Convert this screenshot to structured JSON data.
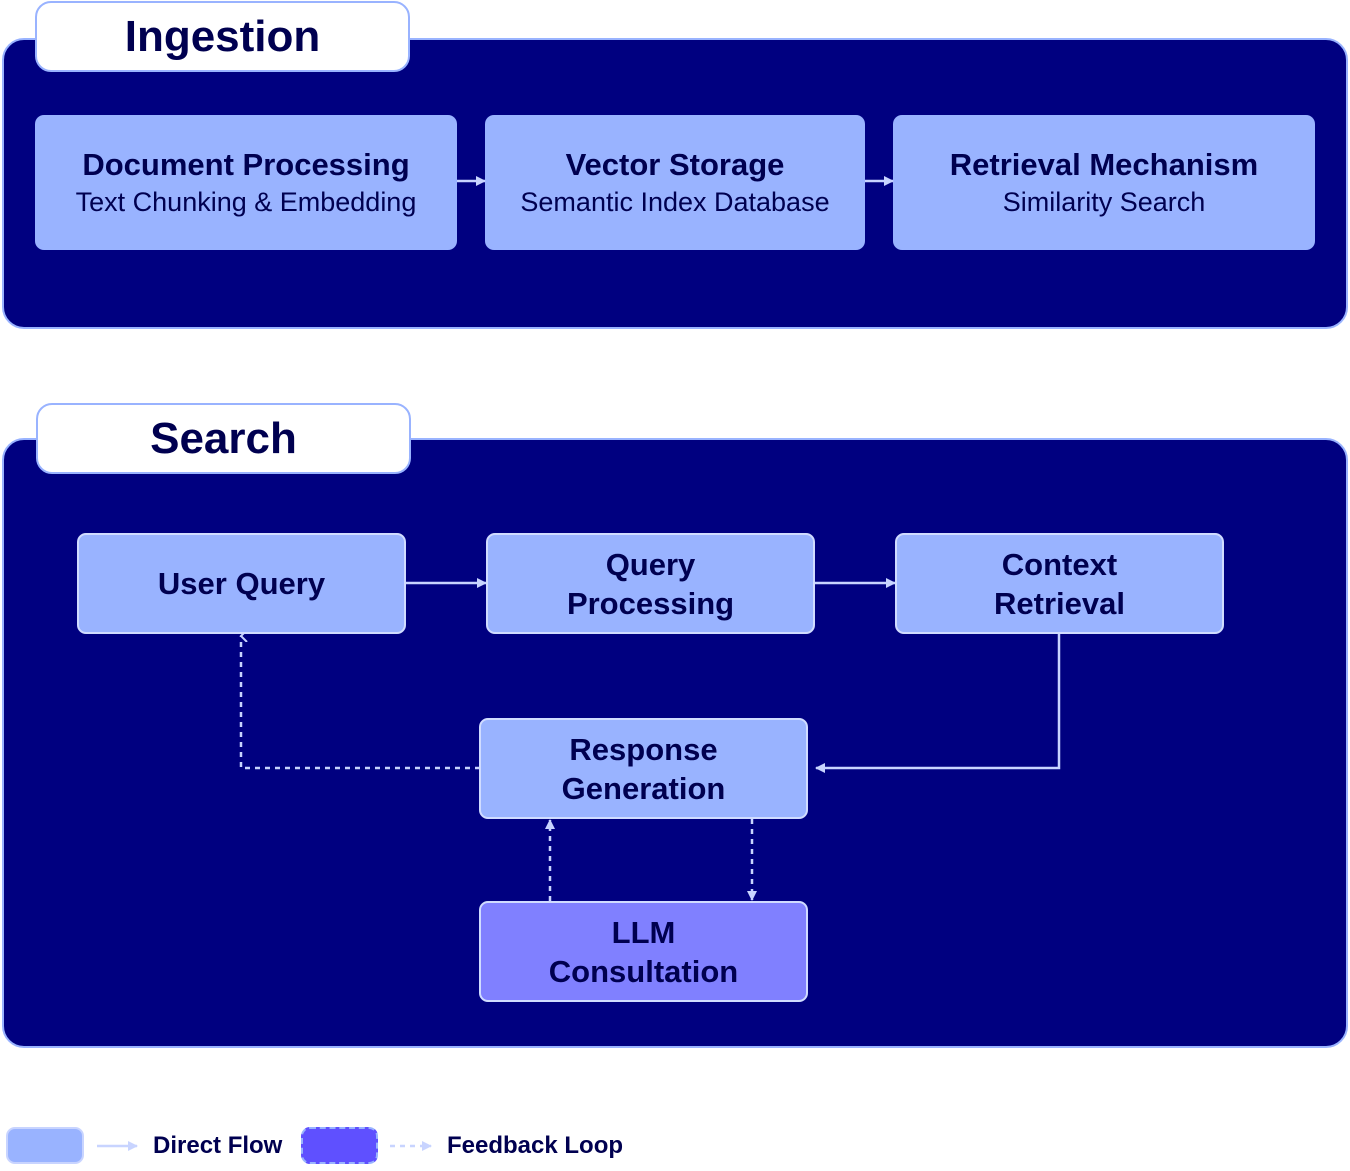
{
  "ingestion": {
    "title": "Ingestion",
    "nodes": [
      {
        "title": "Document Processing",
        "subtitle": "Text Chunking & Embedding"
      },
      {
        "title": "Vector Storage",
        "subtitle": "Semantic Index Database"
      },
      {
        "title": "Retrieval Mechanism",
        "subtitle": "Similarity Search"
      }
    ]
  },
  "search": {
    "title": "Search",
    "nodes": {
      "user_query": "User Query",
      "query_processing": [
        "Query",
        "Processing"
      ],
      "context_retrieval": [
        "Context",
        "Retrieval"
      ],
      "response_generation": [
        "Response",
        "Generation"
      ],
      "llm_consultation": [
        "LLM",
        "Consultation"
      ]
    }
  },
  "legend": {
    "direct_flow": "Direct Flow",
    "feedback_loop": "Feedback Loop"
  },
  "colors": {
    "cluster_bg": "#000080",
    "node_fill": "#99b3ff",
    "llm_fill": "#8080ff",
    "text": "#000050",
    "edge": "#c8d4ff",
    "legend_feedback_swatch": "#5f50ff"
  }
}
